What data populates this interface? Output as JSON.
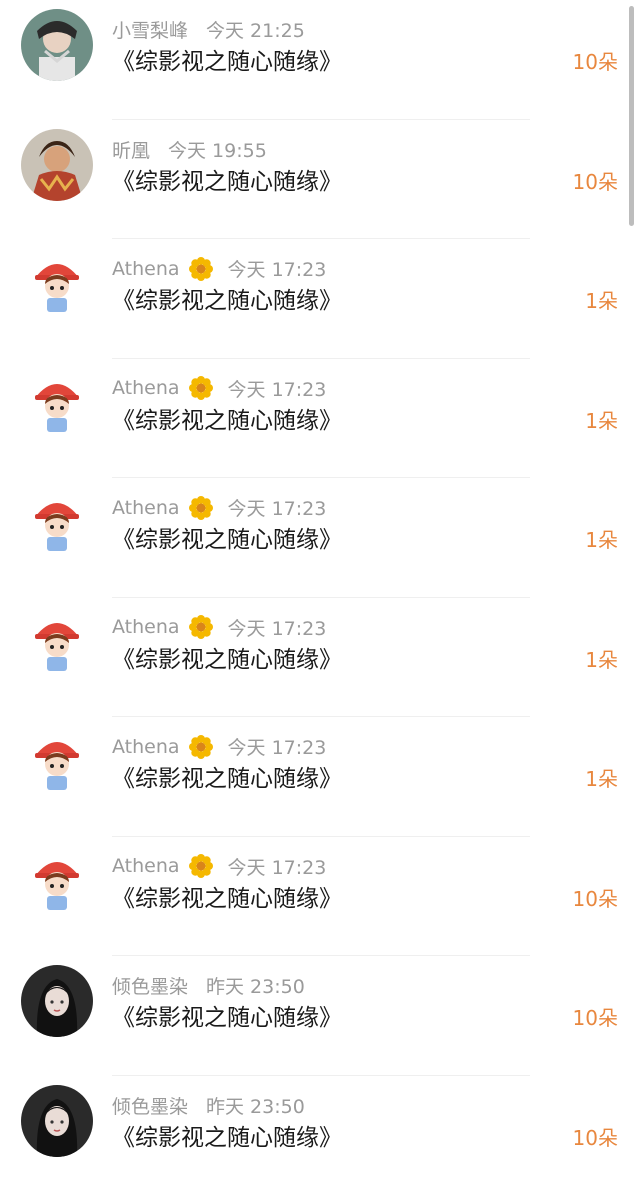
{
  "items": [
    {
      "name": "小雪梨峰",
      "time": "今天 21:25",
      "title": "《综影视之随心随缘》",
      "count": "10朵",
      "avatar": "man-avatar"
    },
    {
      "name": "昕凰",
      "time": "今天 19:55",
      "title": "《综影视之随心随缘》",
      "count": "10朵",
      "avatar": "warrior-avatar"
    },
    {
      "name": "Athena",
      "time": "今天 17:23",
      "title": "《综影视之随心随缘》",
      "count": "1朵",
      "avatar": "cartoon-girl-avatar"
    },
    {
      "name": "Athena",
      "time": "今天 17:23",
      "title": "《综影视之随心随缘》",
      "count": "1朵",
      "avatar": "cartoon-girl-avatar"
    },
    {
      "name": "Athena",
      "time": "今天 17:23",
      "title": "《综影视之随心随缘》",
      "count": "1朵",
      "avatar": "cartoon-girl-avatar"
    },
    {
      "name": "Athena",
      "time": "今天 17:23",
      "title": "《综影视之随心随缘》",
      "count": "1朵",
      "avatar": "cartoon-girl-avatar"
    },
    {
      "name": "Athena",
      "time": "今天 17:23",
      "title": "《综影视之随心随缘》",
      "count": "1朵",
      "avatar": "cartoon-girl-avatar"
    },
    {
      "name": "Athena",
      "time": "今天 17:23",
      "title": "《综影视之随心随缘》",
      "count": "10朵",
      "avatar": "cartoon-girl-avatar"
    },
    {
      "name": "倾色墨染",
      "time": "昨天 23:50",
      "title": "《综影视之随心随缘》",
      "count": "10朵",
      "avatar": "ink-woman-avatar"
    },
    {
      "name": "倾色墨染",
      "time": "昨天 23:50",
      "title": "《综影视之随心随缘》",
      "count": "10朵",
      "avatar": "ink-woman-avatar"
    }
  ],
  "colors": {
    "count": "#e8873e",
    "meta": "#9a9a9a",
    "title": "#1a1a1a"
  }
}
